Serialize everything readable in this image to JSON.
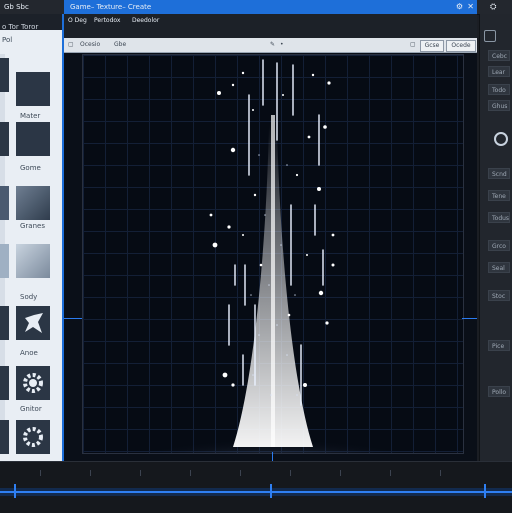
{
  "window": {
    "title": "Game– Texture– Create",
    "left_tab": "Gb Sbc",
    "menu_items": [
      "O Deg",
      "Pertodox",
      "Deedolor"
    ]
  },
  "left_panel": {
    "header": "o Tor Toror",
    "assets": [
      {
        "label": "",
        "icon": "dark-square"
      },
      {
        "label": "Mater",
        "icon": "dark-square"
      },
      {
        "label": "",
        "icon": "dark-square"
      },
      {
        "label": "Gome",
        "icon": "dark-square"
      },
      {
        "label": "",
        "icon": "gradient-square"
      },
      {
        "label": "Granes",
        "icon": "gradient-square"
      },
      {
        "label": "",
        "icon": "light-square"
      },
      {
        "label": "Sody",
        "icon": "light-square"
      },
      {
        "label": "",
        "icon": "star-shape-icon"
      },
      {
        "label": "Anoe",
        "icon": "star-shape-icon"
      },
      {
        "label": "",
        "icon": "gear-icon"
      },
      {
        "label": "Gnitor",
        "icon": "gear-icon"
      },
      {
        "label": "",
        "icon": "gear-icon"
      }
    ],
    "label_left": "Pol"
  },
  "toolbar": {
    "item1": "Ocesio",
    "item2": "Gbe",
    "button1": "Gcse",
    "button2": "Ocede"
  },
  "right_panel": {
    "rows": [
      "Cebc",
      "Lear",
      "Todo",
      "Ghus",
      "Scnd",
      "Tene",
      "Todus",
      "Grco",
      "Seal",
      "Stoc",
      "Pice",
      "Pollo"
    ]
  },
  "colors": {
    "accent": "#1e6fd9",
    "viewport_bg": "#060b14",
    "particle": "#e9f1ff"
  }
}
